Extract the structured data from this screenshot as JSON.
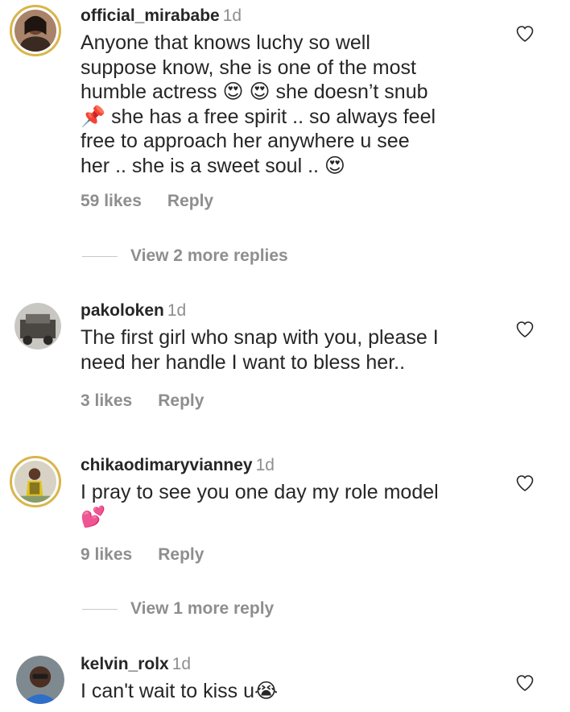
{
  "comments": [
    {
      "username": "official_mirababe",
      "time": "1d",
      "lines": [
        "Anyone that knows luchy so well",
        "suppose know, she is one of the most",
        "humble actress 😍 😍  she doesn’t snub",
        "📌  she has a free spirit .. so always feel",
        "free to approach her anywhere u see",
        "her .. she is a sweet soul .. 😍"
      ],
      "likes": "59 likes",
      "reply": "Reply",
      "view_more": "View 2 more replies"
    },
    {
      "username": "pakoloken",
      "time": "1d",
      "lines": [
        "The first girl who snap with you, please I",
        "need her handle I want to bless her.."
      ],
      "likes": "3 likes",
      "reply": "Reply"
    },
    {
      "username": "chikaodimaryvianney",
      "time": "1d",
      "lines": [
        "I pray to see you one day my role model",
        "💕"
      ],
      "likes": "9 likes",
      "reply": "Reply",
      "view_more": "View 1 more reply"
    },
    {
      "username": "kelvin_rolx",
      "time": "1d",
      "lines": [
        "I can't wait to kiss u😭"
      ]
    }
  ],
  "icons": {
    "like": "heart-outline-icon"
  },
  "colors": {
    "text": "#262626",
    "secondary": "#8e8e8e",
    "story_ring": "#d9b54a"
  }
}
